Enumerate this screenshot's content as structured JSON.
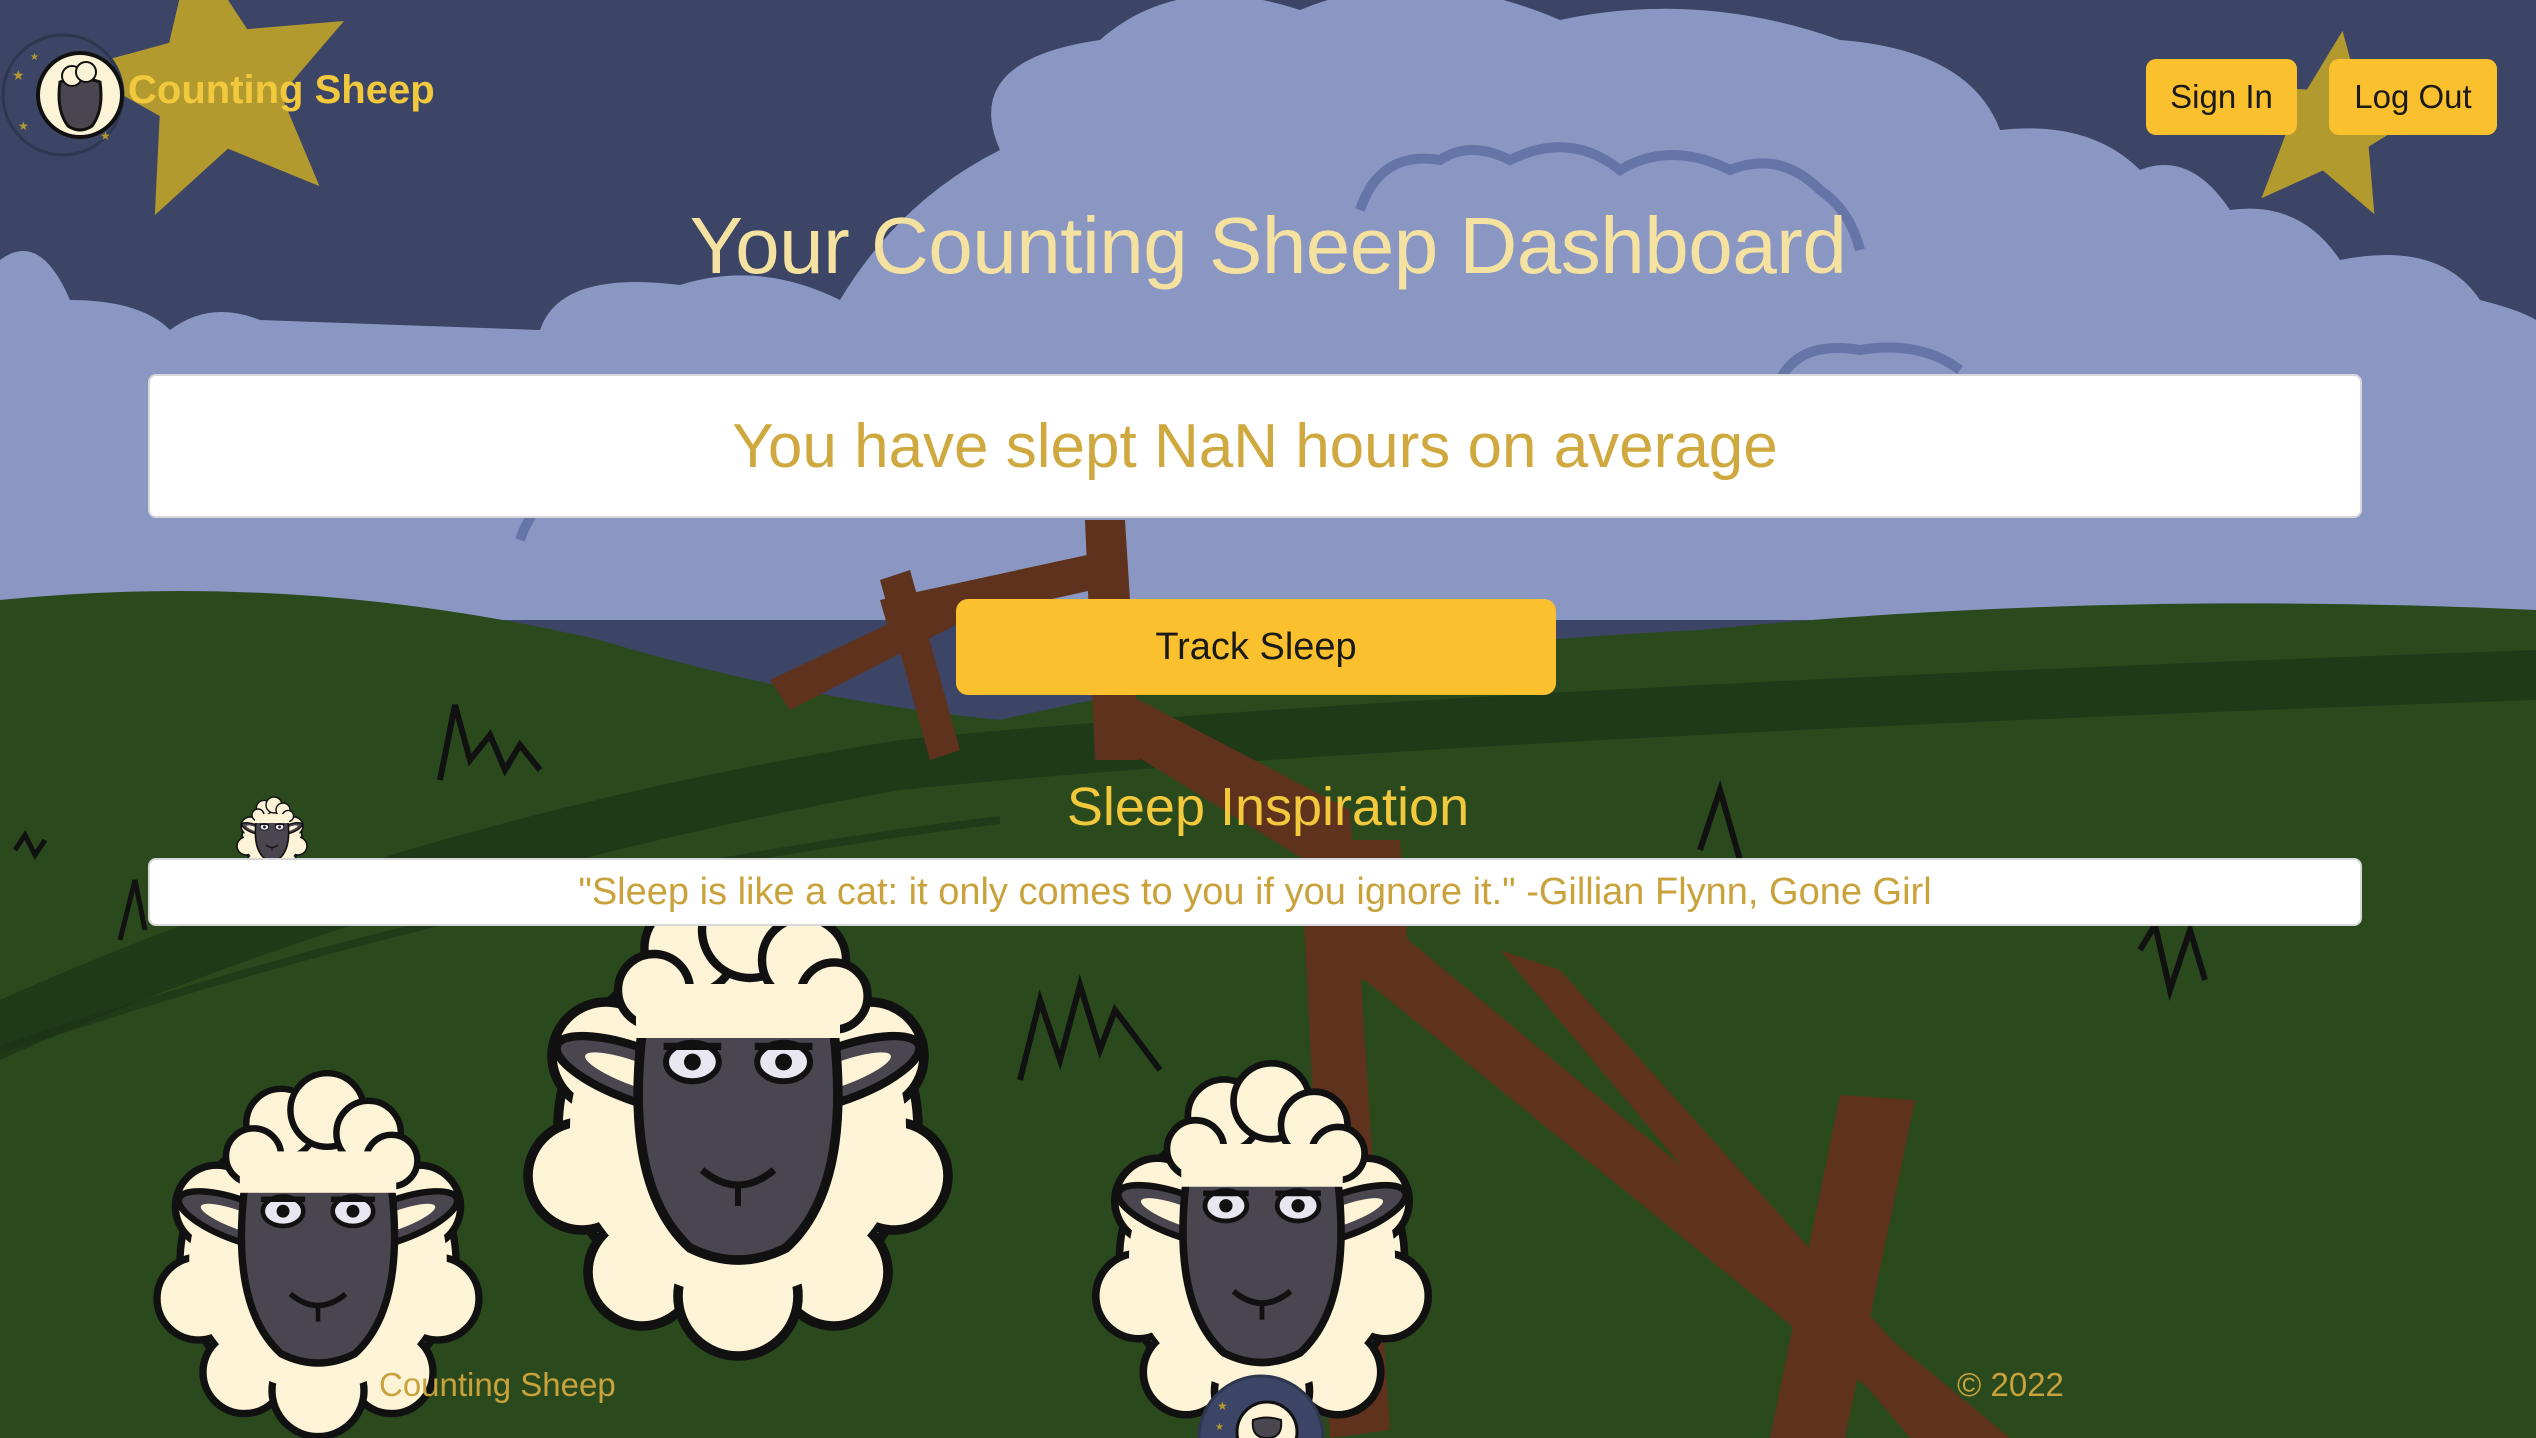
{
  "app": {
    "brand_name": "Counting Sheep"
  },
  "nav": {
    "sign_in_label": "Sign In",
    "log_out_label": "Log Out"
  },
  "main": {
    "title": "Your Counting Sheep Dashboard",
    "average_text": "You have slept NaN hours on average",
    "track_button_label": "Track Sleep",
    "inspiration_heading": "Sleep Inspiration",
    "quote": "\"Sleep is like a cat: it only comes to you if you ignore it.\" -Gillian Flynn, Gone Girl"
  },
  "footer": {
    "brand": "Counting Sheep",
    "copyright": "© 2022"
  },
  "colors": {
    "night_sky": "#3c4566",
    "cloud": "#8a97c3",
    "hill_dark": "#1f3a17",
    "hill": "#2a4a1e",
    "fence": "#5e321c",
    "accent_yellow": "#fbc02d",
    "title_text": "#f6e2a0",
    "gold_text": "#cfa93f",
    "star": "#b39a2e"
  },
  "icons": {
    "logo": "sheep-logo-icon",
    "stars": "star-icon"
  }
}
